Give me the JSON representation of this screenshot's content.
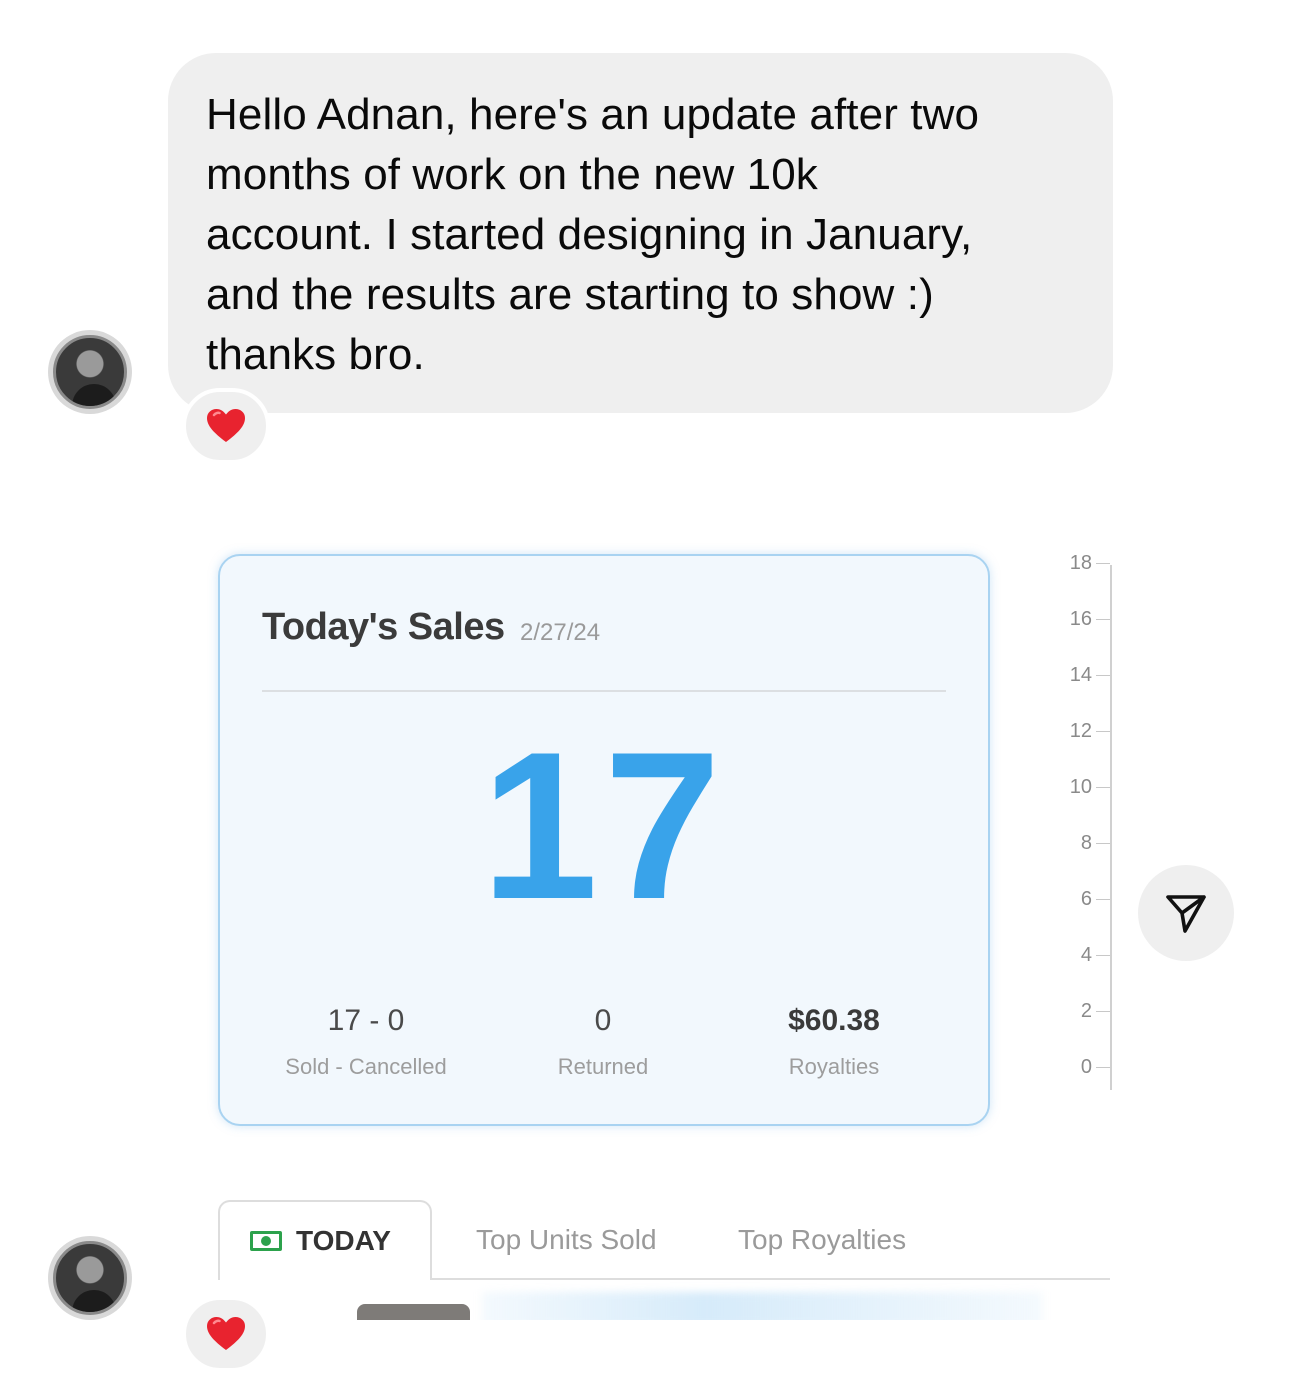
{
  "message": {
    "text": "Hello Adnan, here's an update after two\nmonths of work on the new 10k\naccount. I started designing in January,\nand the results are starting to show :)\nthanks bro.",
    "reaction": "heart"
  },
  "shared_image": {
    "card": {
      "title": "Today's Sales",
      "date": "2/27/24",
      "total": "17",
      "stats": [
        {
          "value": "17 - 0",
          "label": "Sold - Cancelled"
        },
        {
          "value": "0",
          "label": "Returned"
        },
        {
          "value": "$60.38",
          "label": "Royalties"
        }
      ],
      "accent_color": "#39a3ea"
    },
    "axis_ticks": [
      "18",
      "16",
      "14",
      "12",
      "10",
      "8",
      "6",
      "4",
      "2",
      "0"
    ],
    "tabs": [
      {
        "label": "TODAY",
        "icon": "cash-icon",
        "active": true
      },
      {
        "label": "Top Units Sold",
        "active": false
      },
      {
        "label": "Top Royalties",
        "active": false
      }
    ],
    "reaction": "heart"
  },
  "share_button": {
    "icon": "send-icon"
  }
}
